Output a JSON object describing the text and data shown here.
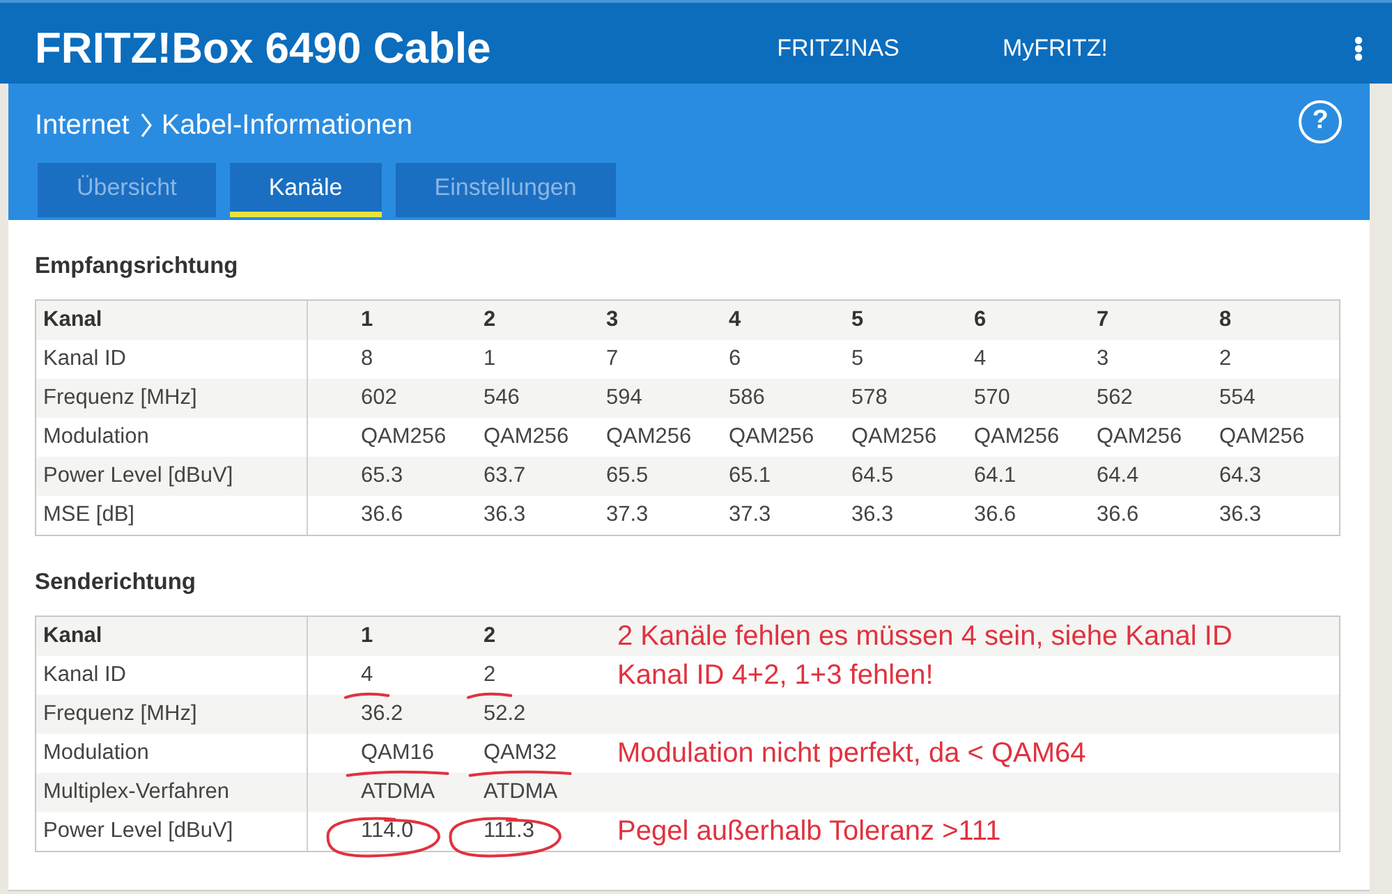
{
  "header": {
    "title": "FRITZ!Box 6490 Cable",
    "links": [
      "FRITZ!NAS",
      "MyFRITZ!"
    ]
  },
  "panel": {
    "breadcrumb": [
      "Internet",
      "Kabel-Informationen"
    ],
    "help": "?",
    "tabs": [
      {
        "label": "Übersicht",
        "selected": false
      },
      {
        "label": "Kanäle",
        "selected": true
      },
      {
        "label": "Einstellungen",
        "selected": false
      }
    ]
  },
  "downstream": {
    "title": "Empfangsrichtung",
    "header": {
      "label": "Kanal",
      "cells": [
        "1",
        "2",
        "3",
        "4",
        "5",
        "6",
        "7",
        "8"
      ]
    },
    "rows": [
      {
        "label": "Kanal ID",
        "cells": [
          "8",
          "1",
          "7",
          "6",
          "5",
          "4",
          "3",
          "2"
        ]
      },
      {
        "label": "Frequenz [MHz]",
        "cells": [
          "602",
          "546",
          "594",
          "586",
          "578",
          "570",
          "562",
          "554"
        ]
      },
      {
        "label": "Modulation",
        "cells": [
          "QAM256",
          "QAM256",
          "QAM256",
          "QAM256",
          "QAM256",
          "QAM256",
          "QAM256",
          "QAM256"
        ]
      },
      {
        "label": "Power Level [dBuV]",
        "cells": [
          "65.3",
          "63.7",
          "65.5",
          "65.1",
          "64.5",
          "64.1",
          "64.4",
          "64.3"
        ]
      },
      {
        "label": "MSE [dB]",
        "cells": [
          "36.6",
          "36.3",
          "37.3",
          "37.3",
          "36.3",
          "36.6",
          "36.6",
          "36.3"
        ]
      }
    ]
  },
  "upstream": {
    "title": "Senderichtung",
    "header": {
      "label": "Kanal",
      "cells": [
        "1",
        "2"
      ],
      "note": "2 Kanäle fehlen es müssen 4 sein, siehe Kanal ID"
    },
    "rows": [
      {
        "label": "Kanal ID",
        "cells": [
          {
            "text": "4",
            "kind": "underlined"
          },
          {
            "text": "2",
            "kind": "underlined"
          }
        ],
        "note": "Kanal ID 4+2, 1+3 fehlen!"
      },
      {
        "label": "Frequenz [MHz]",
        "cells": [
          {
            "text": "36.2",
            "kind": "plain"
          },
          {
            "text": "52.2",
            "kind": "plain"
          }
        ]
      },
      {
        "label": "Modulation",
        "cells": [
          {
            "text": "QAM16",
            "kind": "underlined"
          },
          {
            "text": "QAM32",
            "kind": "underlined"
          }
        ],
        "note": "Modulation nicht perfekt, da < QAM64"
      },
      {
        "label": "Multiplex-Verfahren",
        "cells": [
          {
            "text": "ATDMA",
            "kind": "plain"
          },
          {
            "text": "ATDMA",
            "kind": "plain"
          }
        ]
      },
      {
        "label": "Power Level [dBuV]",
        "cells": [
          {
            "text": "114.0",
            "kind": "circled"
          },
          {
            "text": "111.3",
            "kind": "circled"
          }
        ],
        "note": "Pegel außerhalb Toleranz >111"
      }
    ]
  }
}
